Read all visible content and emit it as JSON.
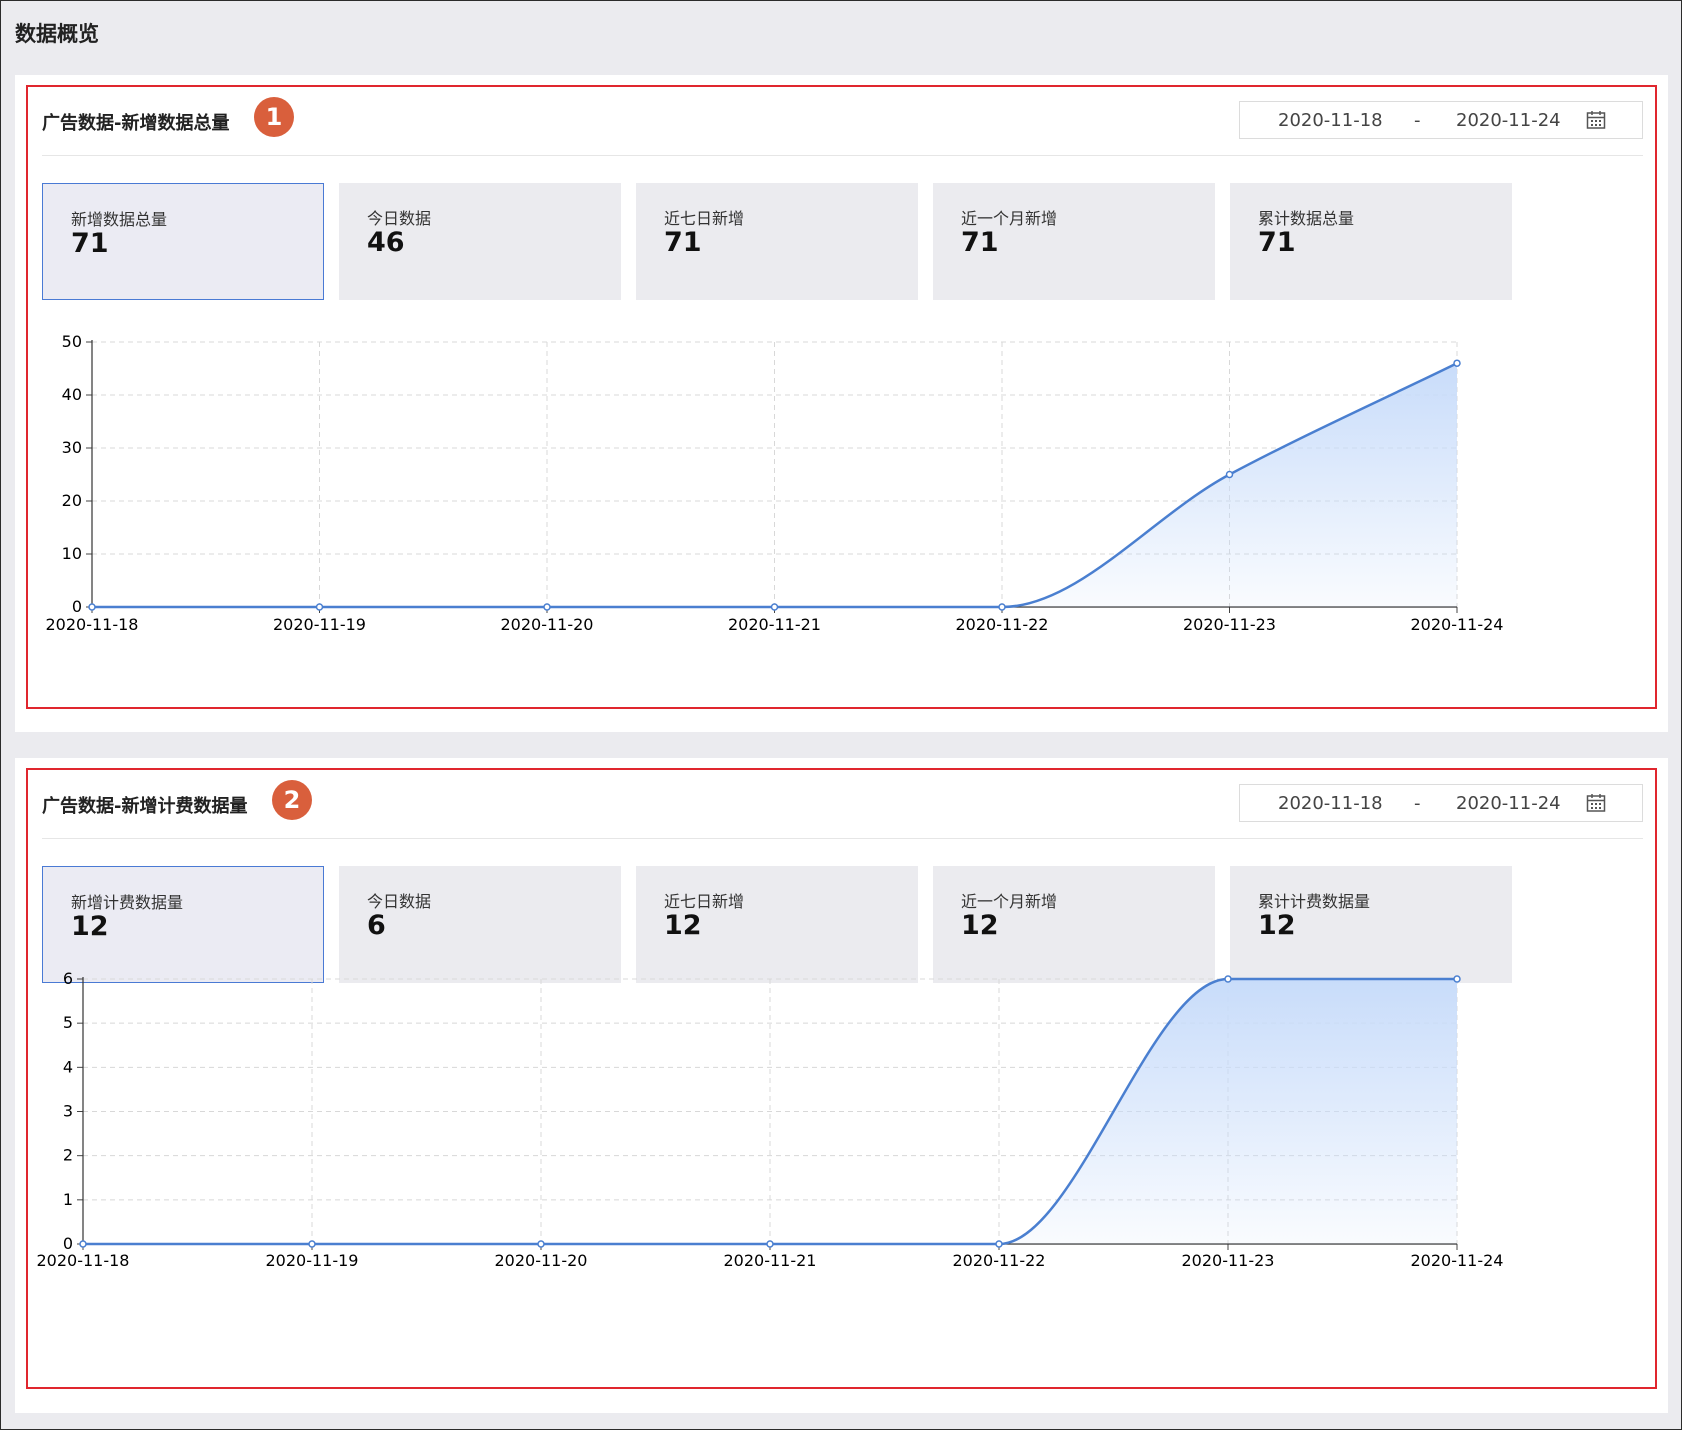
{
  "page": {
    "title": "数据概览"
  },
  "panels": [
    {
      "title": "广告数据-新增数据总量",
      "badge": "1",
      "date_start": "2020-11-18",
      "date_sep": "-",
      "date_end": "2020-11-24",
      "cards": [
        {
          "label": "新增数据总量",
          "value": "71"
        },
        {
          "label": "今日数据",
          "value": "46"
        },
        {
          "label": "近七日新增",
          "value": "71"
        },
        {
          "label": "近一个月新增",
          "value": "71"
        },
        {
          "label": "累计数据总量",
          "value": "71"
        }
      ]
    },
    {
      "title": "广告数据-新增计费数据量",
      "badge": "2",
      "date_start": "2020-11-18",
      "date_sep": "-",
      "date_end": "2020-11-24",
      "cards": [
        {
          "label": "新增计费数据量",
          "value": "12"
        },
        {
          "label": "今日数据",
          "value": "6"
        },
        {
          "label": "近七日新增",
          "value": "12"
        },
        {
          "label": "近一个月新增",
          "value": "12"
        },
        {
          "label": "累计计费数据量",
          "value": "12"
        }
      ]
    }
  ],
  "colors": {
    "line": "#4a7fd0",
    "area": "#c8dcfa",
    "highlight": "#e0262e",
    "badge": "#d95f3c"
  },
  "icons": {
    "date": "calendar-icon"
  },
  "chart_data": [
    {
      "type": "area",
      "x": [
        "2020-11-18",
        "2020-11-19",
        "2020-11-20",
        "2020-11-21",
        "2020-11-22",
        "2020-11-23",
        "2020-11-24"
      ],
      "series": [
        {
          "values": [
            0,
            0,
            0,
            0,
            0,
            25,
            46
          ]
        }
      ],
      "ylim": [
        0,
        50
      ],
      "yticks": [
        0,
        10,
        20,
        30,
        40,
        50
      ],
      "grid": true,
      "smooth": true
    },
    {
      "type": "area",
      "x": [
        "2020-11-18",
        "2020-11-19",
        "2020-11-20",
        "2020-11-21",
        "2020-11-22",
        "2020-11-23",
        "2020-11-24"
      ],
      "series": [
        {
          "values": [
            0,
            0,
            0,
            0,
            0,
            6,
            6
          ]
        }
      ],
      "ylim": [
        0,
        6
      ],
      "yticks": [
        0,
        1,
        2,
        3,
        4,
        5,
        6
      ],
      "grid": true,
      "smooth": true
    }
  ]
}
